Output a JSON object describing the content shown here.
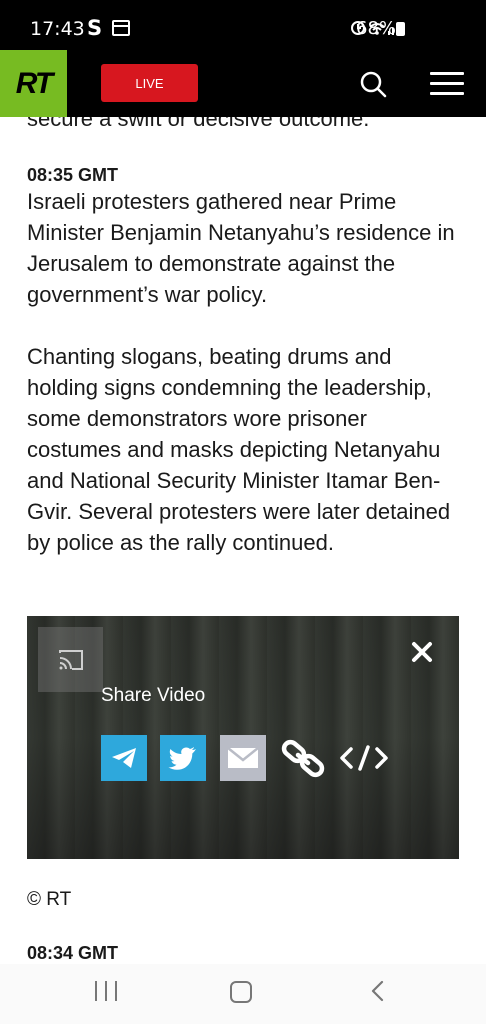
{
  "status_bar": {
    "time": "17:43",
    "s_icon": "S",
    "battery": "68%"
  },
  "navbar": {
    "logo": "RT",
    "live_label": "LIVE"
  },
  "article": {
    "clipped_line": "secure a swift or decisive outcome.",
    "entry1_time": "08:35 GMT",
    "entry1_para1": "Israeli protesters gathered near Prime Minister Benjamin Netanyahu’s residence in Jerusalem to demonstrate against the government’s war policy.",
    "entry1_para2": "Chanting slogans, beating drums and holding signs condemning the leadership, some demonstrators wore prisoner costumes and masks depicting Netanyahu and National Security Minister Itamar Ben-Gvir. Several protesters were later detained by police as the rally continued.",
    "copyright": "© RT",
    "entry2_time": "08:34 GMT"
  },
  "video": {
    "share_title": "Share Video",
    "share_options": [
      "telegram-icon",
      "twitter-icon",
      "email-icon",
      "link-icon",
      "embed-icon"
    ]
  },
  "colors": {
    "brand_green": "#77bb22",
    "live_red": "#d7171f",
    "share_blue": "#2ea8dc"
  }
}
